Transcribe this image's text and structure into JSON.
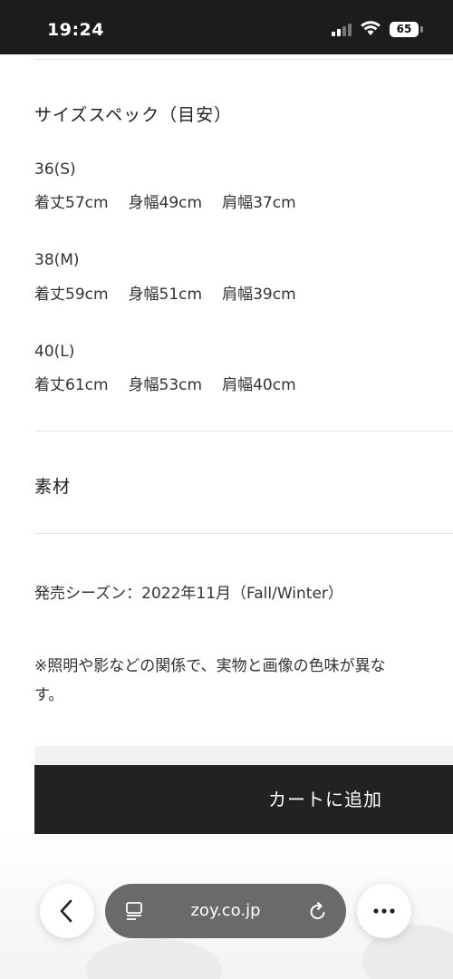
{
  "status_bar": {
    "time": "19:24",
    "battery": "65"
  },
  "size_spec": {
    "title": "サイズスペック（目安）",
    "sizes": [
      {
        "label": "36(S)",
        "length": "着丈57cm",
        "width": "身幅49cm",
        "shoulder": "肩幅37cm"
      },
      {
        "label": "38(M)",
        "length": "着丈59cm",
        "width": "身幅51cm",
        "shoulder": "肩幅39cm"
      },
      {
        "label": "40(L)",
        "length": "着丈61cm",
        "width": "身幅53cm",
        "shoulder": "肩幅40cm"
      }
    ]
  },
  "material": {
    "title": "素材"
  },
  "release": {
    "text": "発売シーズン：2022年11月（Fall/Winter）"
  },
  "note": {
    "line1": "※照明や影などの関係で、実物と画像の色味が異な",
    "line2": "す。"
  },
  "cart": {
    "button_label": "カートに追加"
  },
  "browser": {
    "url": "zoy.co.jp"
  },
  "colors": {
    "status_bar_bg": "#1c1c1c",
    "cart_button_bg": "#222222",
    "url_bar_bg": "#6a6a6a"
  },
  "icons": [
    "signal-icon",
    "wifi-icon",
    "battery-icon",
    "back-icon",
    "tabs-icon",
    "reload-icon",
    "more-icon"
  ]
}
